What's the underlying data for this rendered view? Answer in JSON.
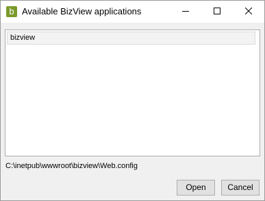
{
  "window": {
    "title": "Available BizView applications",
    "app_icon_letter": "b",
    "app_icon_color": "#7a9a2a"
  },
  "titlebar_buttons": {
    "minimize_icon": "minimize-icon",
    "maximize_icon": "maximize-icon",
    "close_icon": "close-icon"
  },
  "applications": {
    "items": [
      {
        "label": "bizview",
        "selected": true
      }
    ]
  },
  "config_path": "C:\\inetpub\\wwwroot\\bizview\\Web.config",
  "buttons": {
    "open_label": "Open",
    "cancel_label": "Cancel"
  }
}
